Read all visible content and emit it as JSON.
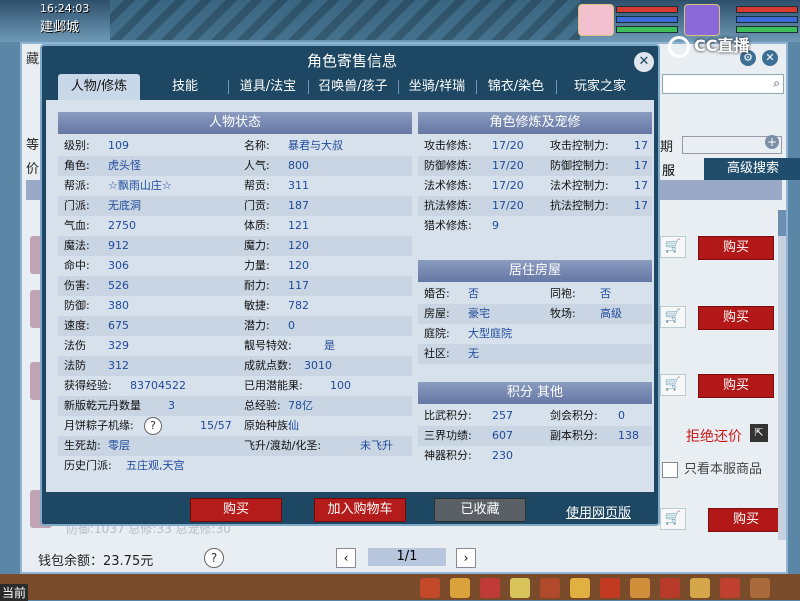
{
  "game": {
    "clock": "16:24:03",
    "city": "建邺城",
    "cur_label": "当前"
  },
  "stream_logo": "CC直播",
  "back_panel": {
    "title": "藏宝",
    "left_labels": [
      "等",
      "价"
    ],
    "period_label": "期",
    "server_label": "服",
    "advanced_search": "高级搜索",
    "buy_label": "购买",
    "refuse_counter": "拒绝还价",
    "only_server": "只看本服商品",
    "wallet": "钱包余额：23.75元",
    "help": "?",
    "page": "1/1",
    "prev": "‹",
    "next": "›",
    "faint_text": "防御:1037 总修:33 总宠修:30"
  },
  "modal": {
    "title": "角色寄售信息",
    "close": "✕",
    "tabs": [
      "人物/修炼",
      "技能",
      "道具/法宝",
      "召唤兽/孩子",
      "坐骑/祥瑞",
      "锦衣/染色",
      "玩家之家"
    ],
    "active_tab": 0,
    "status_head": "人物状态",
    "status_rows": [
      [
        {
          "l": "级别:",
          "v": "109"
        },
        {
          "l": "名称:",
          "v": "暴君与大叔"
        }
      ],
      [
        {
          "l": "角色:",
          "v": "虎头怪"
        },
        {
          "l": "人气:",
          "v": "800"
        }
      ],
      [
        {
          "l": "帮派:",
          "v": "☆飘雨山庄☆"
        },
        {
          "l": "帮贡:",
          "v": "311"
        }
      ],
      [
        {
          "l": "门派:",
          "v": "无底洞"
        },
        {
          "l": "门贡:",
          "v": "187"
        }
      ],
      [
        {
          "l": "气血:",
          "v": "2750"
        },
        {
          "l": "体质:",
          "v": "121"
        }
      ],
      [
        {
          "l": "魔法:",
          "v": "912"
        },
        {
          "l": "魔力:",
          "v": "120"
        }
      ],
      [
        {
          "l": "命中:",
          "v": "306"
        },
        {
          "l": "力量:",
          "v": "120"
        }
      ],
      [
        {
          "l": "伤害:",
          "v": "526"
        },
        {
          "l": "耐力:",
          "v": "117"
        }
      ],
      [
        {
          "l": "防御:",
          "v": "380"
        },
        {
          "l": "敏捷:",
          "v": "782"
        }
      ],
      [
        {
          "l": "速度:",
          "v": "675"
        },
        {
          "l": "潜力:",
          "v": "0"
        }
      ],
      [
        {
          "l": "法伤",
          "v": "329"
        },
        {
          "l": "靓号特效:",
          "v": "是"
        }
      ],
      [
        {
          "l": "法防",
          "v": "312"
        },
        {
          "l": "成就点数:",
          "v": "3010"
        }
      ],
      [
        {
          "l": "获得经验:",
          "v": "83704522"
        },
        {
          "l": "已用潜能果:",
          "v": "100"
        }
      ],
      [
        {
          "l": "新版乾元丹数量",
          "v": "3"
        },
        {
          "l": "总经验:",
          "v": "78亿"
        }
      ],
      [
        {
          "l": "月饼粽子机缘:",
          "v": "15/57"
        },
        {
          "l": "原始种族:",
          "v": "仙"
        }
      ],
      [
        {
          "l": "生死劫:",
          "v": "零层"
        },
        {
          "l": "飞升/渡劫/化圣:",
          "v": "未飞升"
        }
      ],
      [
        {
          "l": "历史门派:",
          "v": "五庄观,天宫"
        },
        {
          "l": "",
          "v": ""
        }
      ]
    ],
    "cultivation_head": "角色修炼及宠修",
    "cultivation_rows": [
      [
        {
          "l": "攻击修炼:",
          "v": "17/20"
        },
        {
          "l": "攻击控制力:",
          "v": "17"
        }
      ],
      [
        {
          "l": "防御修炼:",
          "v": "17/20"
        },
        {
          "l": "防御控制力:",
          "v": "17"
        }
      ],
      [
        {
          "l": "法术修炼:",
          "v": "17/20"
        },
        {
          "l": "法术控制力:",
          "v": "17"
        }
      ],
      [
        {
          "l": "抗法修炼:",
          "v": "17/20"
        },
        {
          "l": "抗法控制力:",
          "v": "17"
        }
      ],
      [
        {
          "l": "猎术修炼:",
          "v": "9"
        },
        {
          "l": "",
          "v": ""
        }
      ]
    ],
    "house_head": "居住房屋",
    "house_rows": [
      [
        {
          "l": "婚否:",
          "v": "否"
        },
        {
          "l": "同袍:",
          "v": "否"
        }
      ],
      [
        {
          "l": "房屋:",
          "v": "豪宅"
        },
        {
          "l": "牧场:",
          "v": "高级"
        }
      ],
      [
        {
          "l": "庭院:",
          "v": "大型庭院"
        },
        {
          "l": "",
          "v": ""
        }
      ],
      [
        {
          "l": "社区:",
          "v": "无"
        },
        {
          "l": "",
          "v": ""
        }
      ]
    ],
    "score_head": "积分 其他",
    "score_rows": [
      [
        {
          "l": "比武积分:",
          "v": "257"
        },
        {
          "l": "剑会积分:",
          "v": "0"
        }
      ],
      [
        {
          "l": "三界功绩:",
          "v": "607"
        },
        {
          "l": "副本积分:",
          "v": "138"
        }
      ],
      [
        {
          "l": "神器积分:",
          "v": "230"
        },
        {
          "l": "",
          "v": ""
        }
      ]
    ],
    "footer": {
      "buy": "购买",
      "add_cart": "加入购物车",
      "collected": "已收藏",
      "web": "使用网页版"
    },
    "help": "?"
  },
  "colors": {
    "modal_bg": "#1d4762",
    "accent_red": "#b41b1b",
    "value_blue": "#1f4a9a"
  }
}
